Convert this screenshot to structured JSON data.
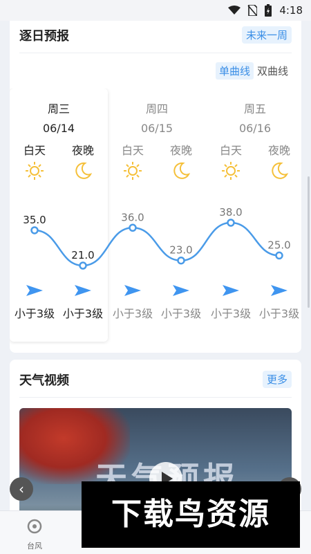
{
  "status_bar": {
    "time": "4:18"
  },
  "daily_forecast": {
    "title": "逐日预报",
    "range_button": "未来一周",
    "toggle": {
      "single": "单曲线",
      "double": "双曲线"
    },
    "days": [
      {
        "weekday": "周三",
        "date": "06/14",
        "day_label": "白天",
        "night_label": "夜晚",
        "day_temp": "35.0",
        "night_temp": "21.0",
        "day_wind": "小于3级",
        "night_wind": "小于3级"
      },
      {
        "weekday": "周四",
        "date": "06/15",
        "day_label": "白天",
        "night_label": "夜晚",
        "day_temp": "36.0",
        "night_temp": "23.0",
        "day_wind": "小于3级",
        "night_wind": "小于3级"
      },
      {
        "weekday": "周五",
        "date": "06/16",
        "day_label": "白天",
        "night_label": "夜晚",
        "day_temp": "38.0",
        "night_temp": "25.0",
        "day_wind": "小于3级",
        "night_wind": "小于3级"
      }
    ],
    "colors": {
      "curve": "#4a9be8",
      "sun": "#f5c03a",
      "arrow": "#3f95f0",
      "accent": "#3a8ee6"
    }
  },
  "weather_video": {
    "title": "天气视频",
    "more_button": "更多",
    "video_title": "天气预报"
  },
  "bottom_nav": {
    "typhoon_label": "台风"
  },
  "watermark": "下载鸟资源"
}
